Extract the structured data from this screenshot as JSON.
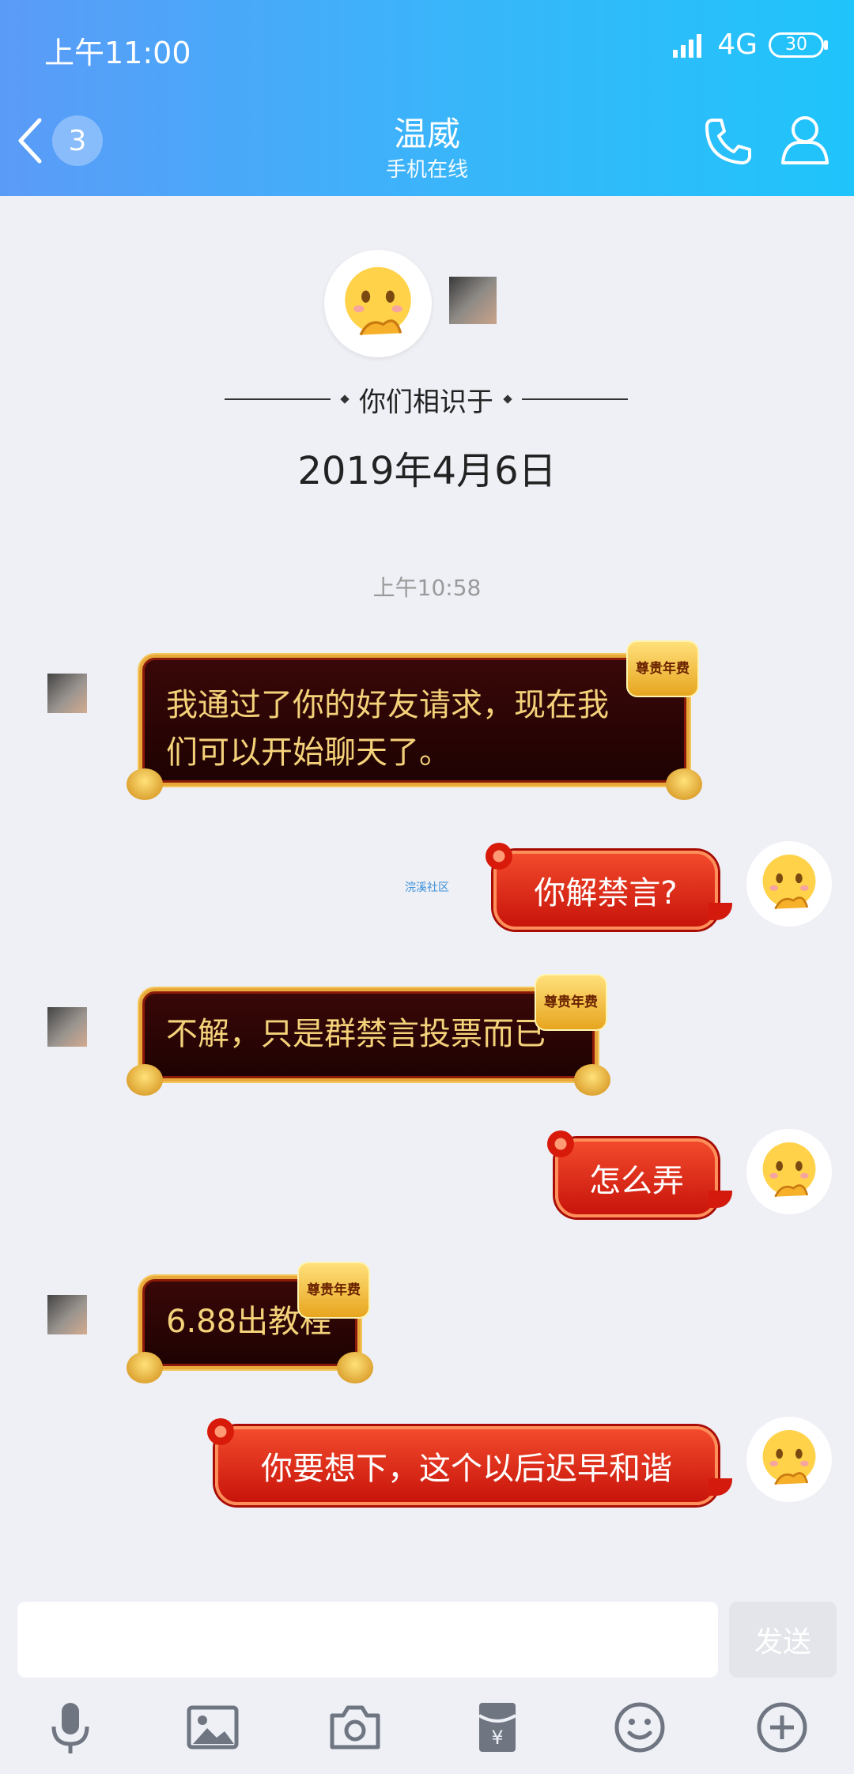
{
  "status": {
    "time": "上午11:00",
    "network": "4G",
    "battery": "30"
  },
  "header": {
    "back_count": "3",
    "title": "温威",
    "subtitle": "手机在线"
  },
  "intro": {
    "met_label": "你们相识于",
    "met_date": "2019年4月6日"
  },
  "timestamp": "上午10:58",
  "watermark": "浣溪社区",
  "messages": [
    {
      "side": "left",
      "lines": [
        "我通过了你的好友请求，现在我",
        "们可以开始聊天了。"
      ],
      "badge": "尊贵年费"
    },
    {
      "side": "right",
      "text": "你解禁言?"
    },
    {
      "side": "left",
      "lines": [
        "不解，只是群禁言投票而已"
      ],
      "badge": "尊贵年费"
    },
    {
      "side": "right",
      "text": "怎么弄"
    },
    {
      "side": "left",
      "lines": [
        "6.88出教程"
      ],
      "badge": "尊贵年费"
    },
    {
      "side": "right",
      "text": "你要想下，这个以后迟早和谐"
    }
  ],
  "input": {
    "send_label": "发送"
  },
  "toolbar": [
    "mic-icon",
    "image-icon",
    "camera-icon",
    "red-packet-icon",
    "emoji-icon",
    "plus-icon"
  ]
}
